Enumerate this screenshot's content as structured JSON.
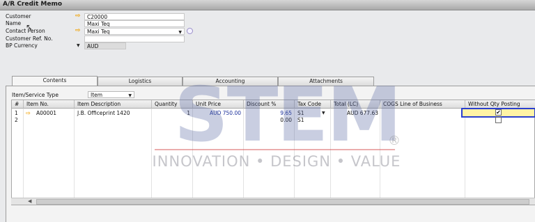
{
  "window": {
    "title": "A/R Credit Memo"
  },
  "header": {
    "customer_label": "Customer",
    "customer_value": "C20000",
    "name_label": "Name",
    "name_value": "Maxi Teq",
    "contact_label": "Contact Person",
    "contact_value": "Maxi Teq",
    "refno_label": "Customer Ref. No.",
    "refno_value": "",
    "currency_label": "BP Currency",
    "currency_value": "AUD"
  },
  "tabs": [
    {
      "label": "Contents",
      "active": true
    },
    {
      "label": "Logistics",
      "active": false
    },
    {
      "label": "Accounting",
      "active": false
    },
    {
      "label": "Attachments",
      "active": false
    }
  ],
  "contents": {
    "item_type_label": "Item/Service Type",
    "item_type_value": "Item",
    "columns": [
      "#",
      "Item No.",
      "Item Description",
      "Quantity",
      "Unit Price",
      "Discount %",
      "Tax Code",
      "Total (LC)",
      "COGS Line of Business",
      "Without Qty Posting"
    ],
    "rows": [
      {
        "num": "1",
        "item_no": "A00001",
        "description": "J.B. Officeprint 1420",
        "quantity": "1",
        "unit_price": "AUD 750.00",
        "discount": "9.65",
        "tax_code": "S1",
        "total": "AUD 677.63",
        "cogs": "",
        "without_qty_posting": true
      },
      {
        "num": "2",
        "item_no": "",
        "description": "",
        "quantity": "",
        "unit_price": "",
        "discount": "0.00",
        "tax_code": "S1",
        "total": "",
        "cogs": "",
        "without_qty_posting": false
      }
    ]
  },
  "watermark": {
    "brand": "STEM",
    "tagline": "INNOVATION • DESIGN • VALUE",
    "registered": "®"
  },
  "icons": {
    "link_arrow": "orange-link-arrow-icon",
    "dropdown": "dropdown-arrow-icon",
    "checkmark": "✔"
  }
}
